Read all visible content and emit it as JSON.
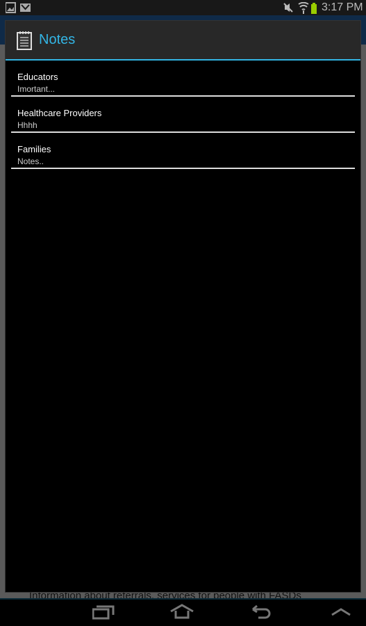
{
  "status": {
    "time": "3:17 PM",
    "icons": [
      "gallery-icon",
      "gmail-icon",
      "mute-icon",
      "wifi-icon",
      "battery-icon"
    ],
    "battery_color": "#99cc00"
  },
  "background": {
    "text": "Information about referrals, services for people with FASDs"
  },
  "dialog": {
    "title": "Notes",
    "title_color": "#33b5e5",
    "icon": "notepad-icon",
    "items": [
      {
        "title": "Educators",
        "subtitle": "Imortant..."
      },
      {
        "title": "Healthcare Providers",
        "subtitle": "Hhhh"
      },
      {
        "title": "Families",
        "subtitle": "Notes.."
      }
    ]
  },
  "nav": {
    "buttons": [
      "recent-apps",
      "home",
      "back",
      "menu-up"
    ]
  }
}
